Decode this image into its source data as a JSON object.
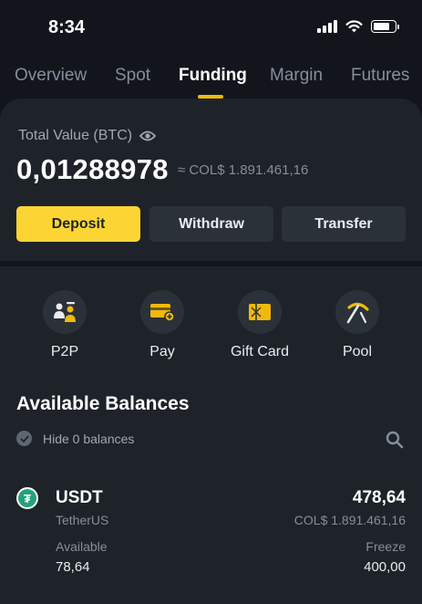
{
  "status_bar": {
    "time": "8:34",
    "signal_icon": "signal-bars-icon",
    "wifi_icon": "wifi-icon",
    "battery_icon": "battery-icon"
  },
  "tabs": [
    {
      "label": "Overview",
      "active": false
    },
    {
      "label": "Spot",
      "active": false
    },
    {
      "label": "Funding",
      "active": true
    },
    {
      "label": "Margin",
      "active": false
    },
    {
      "label": "Futures",
      "active": false
    }
  ],
  "total_value": {
    "label": "Total Value (BTC)",
    "value": "0,01288978",
    "fiat": "≈ COL$  1.891.461,16"
  },
  "actions": {
    "deposit": "Deposit",
    "withdraw": "Withdraw",
    "transfer": "Transfer"
  },
  "shortcuts": [
    {
      "label": "P2P",
      "icon": "p2p-icon"
    },
    {
      "label": "Pay",
      "icon": "pay-card-icon"
    },
    {
      "label": "Gift Card",
      "icon": "gift-card-icon"
    },
    {
      "label": "Pool",
      "icon": "pickaxe-icon"
    }
  ],
  "balances": {
    "title": "Available Balances",
    "hide_zero_label": "Hide 0 balances",
    "assets": [
      {
        "symbol": "USDT",
        "name": "TetherUS",
        "total": "478,64",
        "fiat": "COL$  1.891.461,16",
        "available_label": "Available",
        "available": "78,64",
        "freeze_label": "Freeze",
        "freeze": "400,00"
      }
    ]
  },
  "colors": {
    "background": "#12161c",
    "card": "#1e2329",
    "accent": "#fcd535",
    "button_secondary": "#2b3139",
    "muted_text": "#848e9c",
    "tether_green": "#26a17b"
  }
}
